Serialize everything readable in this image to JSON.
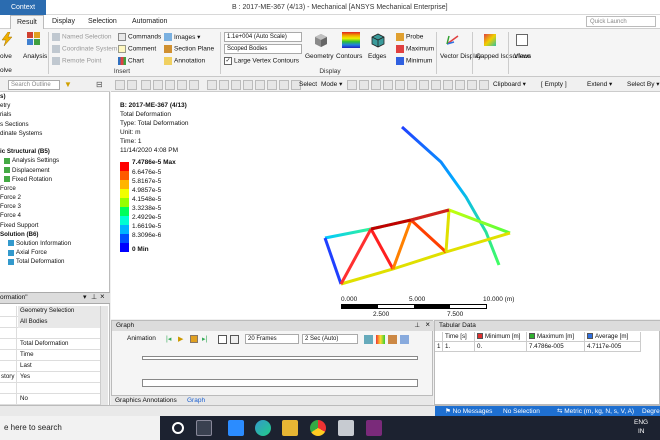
{
  "window": {
    "context_tab": "Context",
    "title": "B : 2017-ME-367 (4/13) - Mechanical [ANSYS Mechanical Enterprise]"
  },
  "ribbon_tabs": [
    "Result",
    "Display",
    "Selection",
    "Automation"
  ],
  "quick_launch_placeholder": "Quick Launch",
  "ribbon": {
    "solve_label": "olve",
    "solve_sub": "olve",
    "analysis_label": "Analysis",
    "named_selection": "Named Selection",
    "coordinate_system": "Coordinate System",
    "remote_point": "Remote Point",
    "commands": "Commands",
    "comment": "Comment",
    "chart": "Chart",
    "images": "Images",
    "section_plane": "Section Plane",
    "annotation": "Annotation",
    "insert_group": "Insert",
    "scale_value": "1.1e+004 (Auto Scale)",
    "scoped_bodies": "Scoped Bodies",
    "large_vertex": "Large Vertex Contours",
    "geometry": "Geometry",
    "contours": "Contours",
    "edges": "Edges",
    "display_group": "Display",
    "probe": "Probe",
    "maximum": "Maximum",
    "minimum": "Minimum",
    "vector_display": "Vector Display",
    "capped_isosurface": "Capped Isosurface",
    "views": "Views"
  },
  "outline": {
    "search_placeholder": "Search Outline",
    "items": [
      {
        "text": "s)",
        "bold": true,
        "indent": 0
      },
      {
        "text": "etry",
        "bold": false,
        "indent": 0
      },
      {
        "text": "rials",
        "bold": false,
        "indent": 0
      },
      {
        "text": "s Sections",
        "bold": false,
        "indent": 0
      },
      {
        "text": "dinate Systems",
        "bold": false,
        "indent": 0
      },
      {
        "text": "",
        "bold": false,
        "indent": 0
      },
      {
        "text": "ic Structural (B5)",
        "bold": true,
        "indent": 0
      },
      {
        "text": "Analysis Settings",
        "bold": false,
        "indent": 1
      },
      {
        "text": "Displacement",
        "bold": false,
        "indent": 1
      },
      {
        "text": "Fixed Rotation",
        "bold": false,
        "indent": 1
      },
      {
        "text": "Force",
        "bold": false,
        "indent": 0
      },
      {
        "text": "Force 2",
        "bold": false,
        "indent": 0
      },
      {
        "text": "Force 3",
        "bold": false,
        "indent": 0
      },
      {
        "text": "Force 4",
        "bold": false,
        "indent": 0
      },
      {
        "text": "Fixed Support",
        "bold": false,
        "indent": 0
      },
      {
        "text": "Solution (B6)",
        "bold": true,
        "indent": 0
      },
      {
        "text": "Solution Information",
        "bold": false,
        "indent": 2
      },
      {
        "text": "Axial Force",
        "bold": false,
        "indent": 2
      },
      {
        "text": "Total Deformation",
        "bold": false,
        "indent": 2
      }
    ]
  },
  "details": {
    "header": "ormation\"",
    "rows": [
      {
        "a": "",
        "b": "Geometry Selection",
        "section": true
      },
      {
        "a": "",
        "b": "All Bodies",
        "section": true
      },
      {
        "a": "",
        "b": "",
        "section": false
      },
      {
        "a": "",
        "b": "Total Deformation",
        "section": false
      },
      {
        "a": "",
        "b": "Time",
        "section": false
      },
      {
        "a": "",
        "b": "Last",
        "section": false
      },
      {
        "a": "story",
        "b": "Yes",
        "section": false
      },
      {
        "a": "",
        "b": "",
        "section": false
      },
      {
        "a": "",
        "b": "No",
        "section": false
      }
    ]
  },
  "graphics_toolbar": {
    "select": "Select",
    "mode": "Mode",
    "clipboard": "Clipboard",
    "empty": "[ Empty ]",
    "extend": "Extend",
    "select_by": "Select By"
  },
  "viewport": {
    "result_title": "B: 2017-ME-367 (4/13)",
    "result_name": "Total Deformation",
    "type": "Type: Total Deformation",
    "unit": "Unit: m",
    "time": "Time: 1",
    "date": "11/14/2020 4:08 PM",
    "legend": {
      "max_label": "7.4786e-5 Max",
      "min_label": "0 Min",
      "values": [
        "6.6476e-5",
        "5.8167e-5",
        "4.9857e-5",
        "4.1548e-5",
        "3.3238e-5",
        "2.4929e-5",
        "1.6619e-5",
        "8.3096e-6"
      ],
      "colors": [
        "#ff0000",
        "#ff5a00",
        "#ffb400",
        "#f2ff00",
        "#96ff00",
        "#00ff5a",
        "#00ffd2",
        "#00b4ff",
        "#0050ff",
        "#0000ff"
      ]
    },
    "scale": {
      "top_labels": [
        "0.000",
        "5.000",
        "10.000 (m)"
      ],
      "bottom_labels": [
        "2.500",
        "7.500"
      ]
    }
  },
  "graph": {
    "header": "Graph",
    "animation": "Animation",
    "frames": "20 Frames",
    "duration": "2 Sec (Auto)",
    "tabs": [
      "Graphics Annotations",
      "Graph"
    ]
  },
  "tabular": {
    "header": "Tabular Data",
    "columns": [
      "Time [s]",
      "Minimum [m]",
      "Maximum [m]",
      "Average [m]"
    ],
    "rows": [
      {
        "index": "1",
        "time": "1.",
        "min": "0.",
        "max": "7.4786e-005",
        "avg": "4.7117e-005"
      }
    ]
  },
  "status": {
    "messages": "No Messages",
    "selection": "No Selection",
    "units": "Metric (m, kg, N, s, V, A)",
    "degrees": "Degre"
  },
  "taskbar": {
    "search": "e here to search",
    "lang": "ENG",
    "region": "IN"
  }
}
